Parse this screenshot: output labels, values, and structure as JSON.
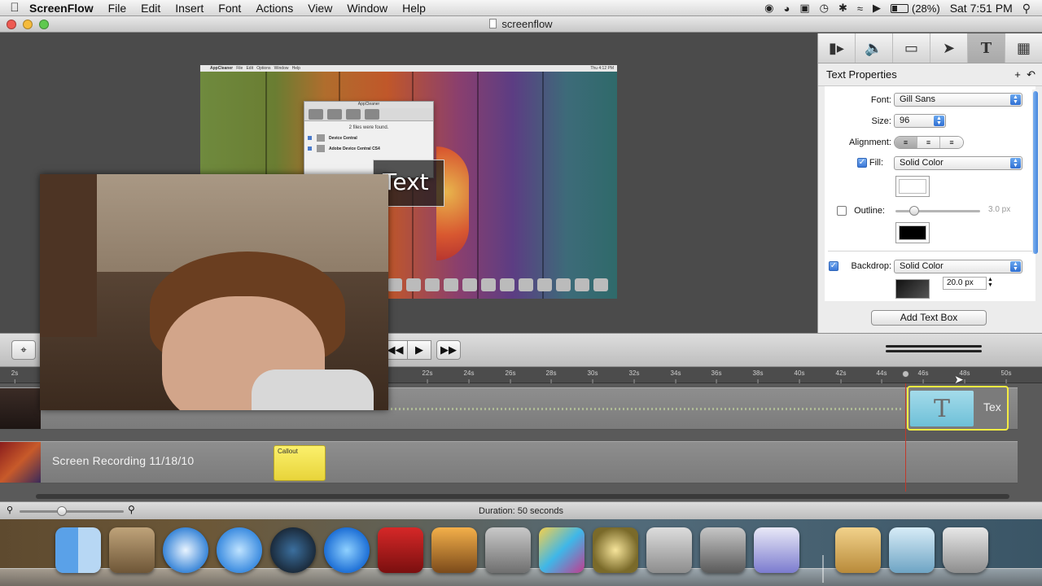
{
  "menubar": {
    "app_name": "ScreenFlow",
    "menus": [
      "File",
      "Edit",
      "Insert",
      "Font",
      "Actions",
      "View",
      "Window",
      "Help"
    ],
    "battery": "(28%)",
    "clock": "Sat 7:51 PM"
  },
  "window": {
    "title": "screenflow"
  },
  "canvas": {
    "overlay_text": "Text",
    "mini_menubar": [
      "AppCleaner",
      "File",
      "Edit",
      "Options",
      "Window",
      "Help"
    ],
    "mini_clock": "Thu 4:12 PM",
    "appcleaner": {
      "title": "AppCleaner",
      "message": "2 files were found.",
      "items": [
        "Device Central",
        "Adobe Device Central CS4"
      ]
    }
  },
  "inspector": {
    "tabs": [
      "video-camera-icon",
      "speaker-icon",
      "display-icon",
      "pointer-icon",
      "text-icon",
      "callout-icon"
    ],
    "active_tab": "text-icon",
    "header": "Text Properties",
    "font_label": "Font:",
    "font_value": "Gill Sans",
    "size_label": "Size:",
    "size_value": "96",
    "alignment_label": "Alignment:",
    "fill_label": "Fill:",
    "fill_value": "Solid Color",
    "fill_checked": true,
    "outline_label": "Outline:",
    "outline_checked": false,
    "outline_width": "3.0 px",
    "backdrop_label": "Backdrop:",
    "backdrop_value": "Solid Color",
    "backdrop_checked": true,
    "backdrop_px": "20.0 px",
    "add_button": "Add Text Box",
    "colors": {
      "fill": "#ffffff",
      "outline": "#000000",
      "accent": "#3a78d8"
    }
  },
  "timeline": {
    "ticks": [
      "2s",
      "22s",
      "24s",
      "26s",
      "28s",
      "30s",
      "32s",
      "34s",
      "36s",
      "38s",
      "40s",
      "42s",
      "44s",
      "46s",
      "48s",
      "50s"
    ],
    "clip_label": "Screen Recording 11/18/10",
    "callout_label": "Callout",
    "text_clip_label": "Tex",
    "duration": "Duration: 50 seconds"
  },
  "dock": {
    "items": [
      "finder-icon",
      "mail-icon",
      "safari-icon",
      "ichat-icon",
      "webcam-icon",
      "itunes-icon",
      "photo-booth-icon",
      "iphoto-icon",
      "imovie-icon",
      "screenflow-icon",
      "star-icon",
      "appcleaner-icon",
      "system-preferences-icon",
      "game-icon",
      "address-book-icon",
      "preview-icon",
      "trash-icon"
    ]
  }
}
